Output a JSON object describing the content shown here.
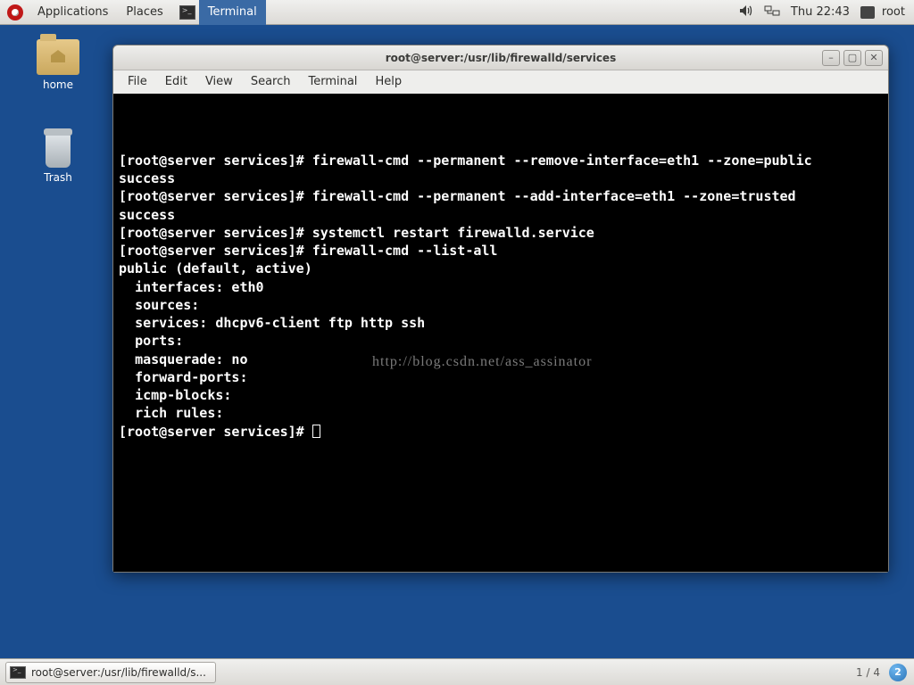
{
  "panel": {
    "applications": "Applications",
    "places": "Places",
    "active_task": "Terminal",
    "clock": "Thu 22:43",
    "user": "root"
  },
  "desktop": {
    "home_label": "home",
    "trash_label": "Trash"
  },
  "window": {
    "title": "root@server:/usr/lib/firewalld/services",
    "menu": {
      "file": "File",
      "edit": "Edit",
      "view": "View",
      "search": "Search",
      "terminal": "Terminal",
      "help": "Help"
    }
  },
  "terminal": {
    "lines": [
      "[root@server services]# firewall-cmd --permanent --remove-interface=eth1 --zone=public",
      "success",
      "[root@server services]# firewall-cmd --permanent --add-interface=eth1 --zone=trusted",
      "success",
      "[root@server services]# systemctl restart firewalld.service",
      "[root@server services]# firewall-cmd --list-all",
      "public (default, active)",
      "  interfaces: eth0",
      "  sources:",
      "  services: dhcpv6-client ftp http ssh",
      "  ports:",
      "  masquerade: no",
      "  forward-ports:",
      "  icmp-blocks:",
      "  rich rules:",
      "",
      "[root@server services]# "
    ],
    "watermark": "http://blog.csdn.net/ass_assinator"
  },
  "taskbar": {
    "task_label": "root@server:/usr/lib/firewalld/s...",
    "workspace_indicator": "1 / 4",
    "workspace_badge": "2"
  }
}
